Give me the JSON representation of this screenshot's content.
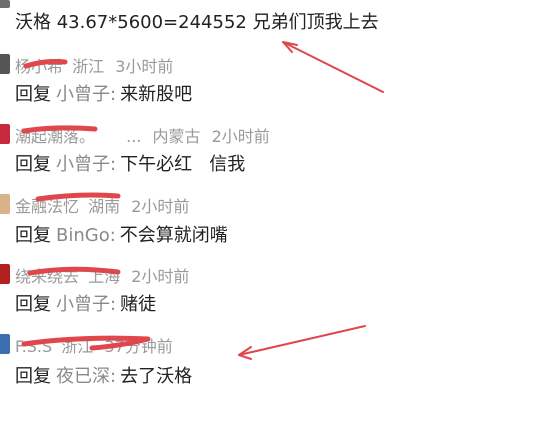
{
  "top_post": {
    "text": "沃格 43.67*5600=244552 兄弟们顶我上去"
  },
  "comments": [
    {
      "user": "杨小希",
      "location": "浙江",
      "time": "3小时前",
      "reply_keyword": "回复",
      "reply_to": "小曾子",
      "colon": ":",
      "text": "来新股吧",
      "avatar_color": "#555555"
    },
    {
      "user": "潮起潮落。",
      "extra": "...",
      "location": "内蒙古",
      "time": "2小时前",
      "reply_keyword": "回复",
      "reply_to": "小曾子",
      "colon": ":",
      "text": "下午必红   信我",
      "avatar_color": "#c8283c"
    },
    {
      "user": "金融法忆",
      "location": "湖南",
      "time": "2小时前",
      "reply_keyword": "回复",
      "reply_to": "BinGo",
      "colon": ":",
      "text": "不会算就闭嘴",
      "avatar_color": "#d9b28a"
    },
    {
      "user": "绕来绕去",
      "location": "上海",
      "time": "2小时前",
      "reply_keyword": "回复",
      "reply_to": "小曾子",
      "colon": ":",
      "text": "赌徒",
      "avatar_color": "#b21f1f"
    },
    {
      "user": "F.S.S",
      "location": "浙江",
      "time": "37分钟前",
      "reply_keyword": "回复",
      "reply_to": "夜已深",
      "colon": ":",
      "text": "去了沃格",
      "avatar_color": "#3b6fb0"
    }
  ],
  "annotation_color": "#e0474c"
}
